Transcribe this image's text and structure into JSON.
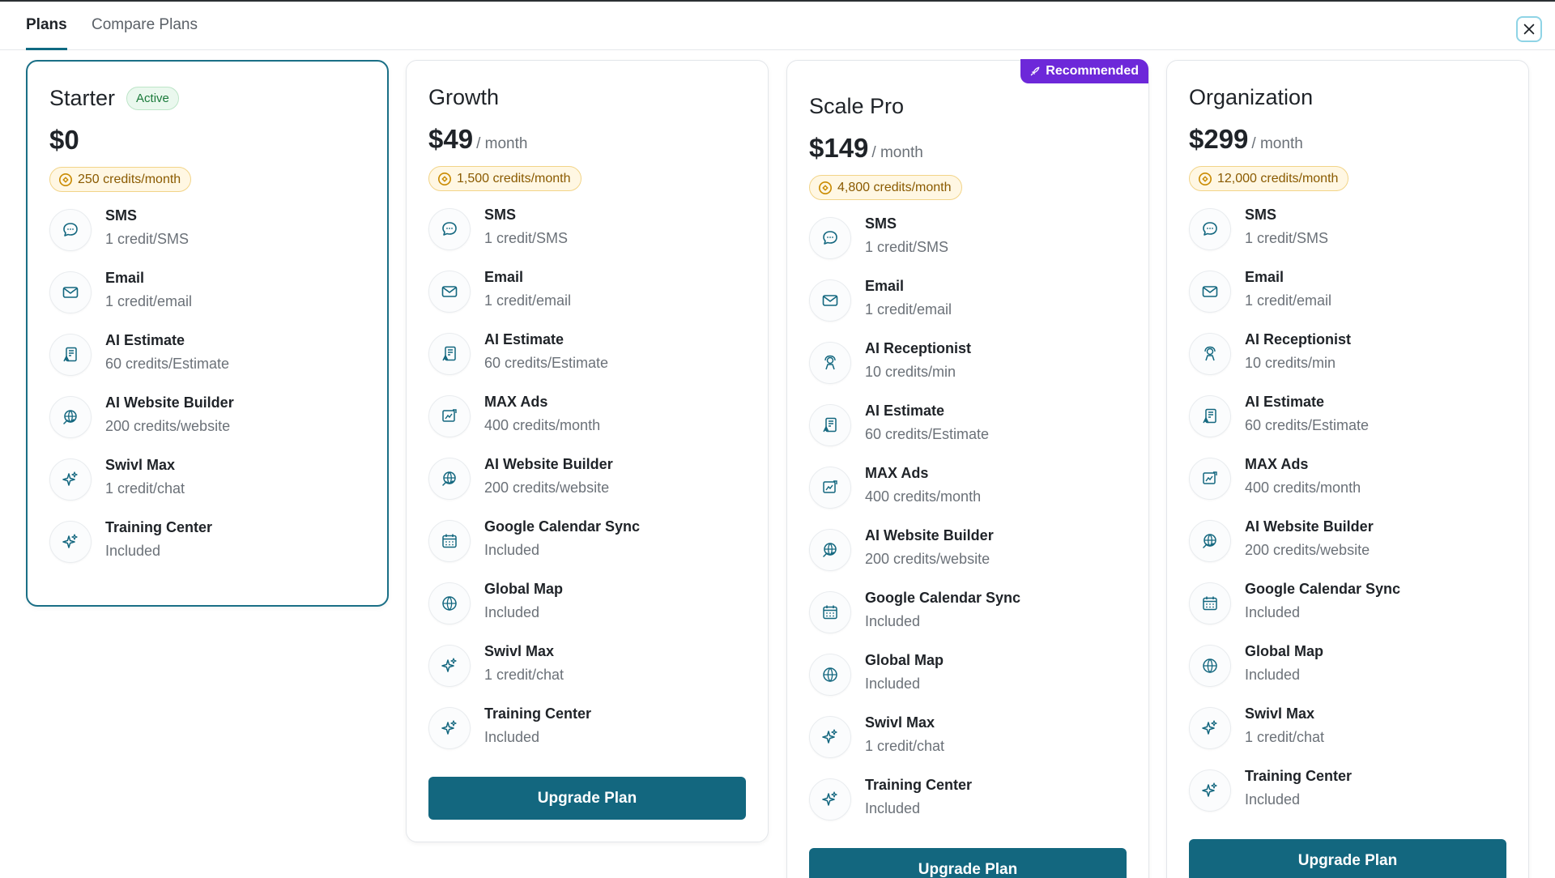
{
  "tabs": [
    {
      "label": "Plans",
      "active": true
    },
    {
      "label": "Compare Plans",
      "active": false
    }
  ],
  "close_icon": "close-icon",
  "colors": {
    "accent": "#13677f",
    "recommended": "#6d28d9",
    "active_badge": "#1a7a3a",
    "credits_badge": "#8a5a00"
  },
  "plans": [
    {
      "name": "Starter",
      "badge": "Active",
      "price": "$0",
      "period": "",
      "credits": "250 credits/month",
      "recommended": "",
      "button": "",
      "features": [
        {
          "icon": "chat-bubble-icon",
          "name": "SMS",
          "desc": "1 credit/SMS"
        },
        {
          "icon": "mail-icon",
          "name": "Email",
          "desc": "1 credit/email"
        },
        {
          "icon": "estimate-icon",
          "name": "AI Estimate",
          "desc": "60 credits/Estimate"
        },
        {
          "icon": "globe-hand-icon",
          "name": "AI Website Builder",
          "desc": "200 credits/website"
        },
        {
          "icon": "sparkle-icon",
          "name": "Swivl Max",
          "desc": "1 credit/chat"
        },
        {
          "icon": "sparkle-icon",
          "name": "Training Center",
          "desc": "Included"
        }
      ]
    },
    {
      "name": "Growth",
      "badge": "",
      "price": "$49",
      "period": "/ month",
      "credits": "1,500 credits/month",
      "recommended": "",
      "button": "Upgrade Plan",
      "features": [
        {
          "icon": "chat-bubble-icon",
          "name": "SMS",
          "desc": "1 credit/SMS"
        },
        {
          "icon": "mail-icon",
          "name": "Email",
          "desc": "1 credit/email"
        },
        {
          "icon": "estimate-icon",
          "name": "AI Estimate",
          "desc": "60 credits/Estimate"
        },
        {
          "icon": "ads-icon",
          "name": "MAX Ads",
          "desc": "400 credits/month"
        },
        {
          "icon": "globe-hand-icon",
          "name": "AI Website Builder",
          "desc": "200 credits/website"
        },
        {
          "icon": "calendar-icon",
          "name": "Google Calendar Sync",
          "desc": "Included"
        },
        {
          "icon": "globe-icon",
          "name": "Global Map",
          "desc": "Included"
        },
        {
          "icon": "sparkle-icon",
          "name": "Swivl Max",
          "desc": "1 credit/chat"
        },
        {
          "icon": "sparkle-icon",
          "name": "Training Center",
          "desc": "Included"
        }
      ]
    },
    {
      "name": "Scale Pro",
      "badge": "",
      "price": "$149",
      "period": "/ month",
      "credits": "4,800 credits/month",
      "recommended": "Recommended",
      "button": "Upgrade Plan",
      "features": [
        {
          "icon": "chat-bubble-icon",
          "name": "SMS",
          "desc": "1 credit/SMS"
        },
        {
          "icon": "mail-icon",
          "name": "Email",
          "desc": "1 credit/email"
        },
        {
          "icon": "receptionist-icon",
          "name": "AI Receptionist",
          "desc": "10 credits/min"
        },
        {
          "icon": "estimate-icon",
          "name": "AI Estimate",
          "desc": "60 credits/Estimate"
        },
        {
          "icon": "ads-icon",
          "name": "MAX Ads",
          "desc": "400 credits/month"
        },
        {
          "icon": "globe-hand-icon",
          "name": "AI Website Builder",
          "desc": "200 credits/website"
        },
        {
          "icon": "calendar-icon",
          "name": "Google Calendar Sync",
          "desc": "Included"
        },
        {
          "icon": "globe-icon",
          "name": "Global Map",
          "desc": "Included"
        },
        {
          "icon": "sparkle-icon",
          "name": "Swivl Max",
          "desc": "1 credit/chat"
        },
        {
          "icon": "sparkle-icon",
          "name": "Training Center",
          "desc": "Included"
        }
      ]
    },
    {
      "name": "Organization",
      "badge": "",
      "price": "$299",
      "period": "/ month",
      "credits": "12,000 credits/month",
      "recommended": "",
      "button": "Upgrade Plan",
      "features": [
        {
          "icon": "chat-bubble-icon",
          "name": "SMS",
          "desc": "1 credit/SMS"
        },
        {
          "icon": "mail-icon",
          "name": "Email",
          "desc": "1 credit/email"
        },
        {
          "icon": "receptionist-icon",
          "name": "AI Receptionist",
          "desc": "10 credits/min"
        },
        {
          "icon": "estimate-icon",
          "name": "AI Estimate",
          "desc": "60 credits/Estimate"
        },
        {
          "icon": "ads-icon",
          "name": "MAX Ads",
          "desc": "400 credits/month"
        },
        {
          "icon": "globe-hand-icon",
          "name": "AI Website Builder",
          "desc": "200 credits/website"
        },
        {
          "icon": "calendar-icon",
          "name": "Google Calendar Sync",
          "desc": "Included"
        },
        {
          "icon": "globe-icon",
          "name": "Global Map",
          "desc": "Included"
        },
        {
          "icon": "sparkle-icon",
          "name": "Swivl Max",
          "desc": "1 credit/chat"
        },
        {
          "icon": "sparkle-icon",
          "name": "Training Center",
          "desc": "Included"
        }
      ]
    }
  ]
}
